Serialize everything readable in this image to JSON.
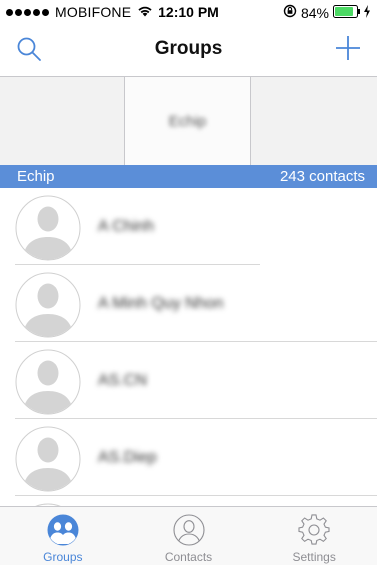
{
  "status_bar": {
    "carrier": "MOBIFONE",
    "time": "12:10 PM",
    "battery": "84%"
  },
  "nav": {
    "title": "Groups"
  },
  "group_grid": {
    "cells": [
      {
        "label": ""
      },
      {
        "label": "Echip"
      },
      {
        "label": ""
      }
    ]
  },
  "group_header": {
    "name": "Echip",
    "count": "243 contacts"
  },
  "contacts": [
    {
      "name": "A Chinh"
    },
    {
      "name": "A Minh Quy Nhon"
    },
    {
      "name": "AS.CN"
    },
    {
      "name": "AS.Diep"
    },
    {
      "name": ""
    }
  ],
  "tabs": [
    {
      "label": "Groups",
      "active": true
    },
    {
      "label": "Contacts",
      "active": false
    },
    {
      "label": "Settings",
      "active": false
    }
  ],
  "colors": {
    "accent": "#4a86d8",
    "header_bar": "#5b8ed8",
    "battery": "#4cd964"
  }
}
